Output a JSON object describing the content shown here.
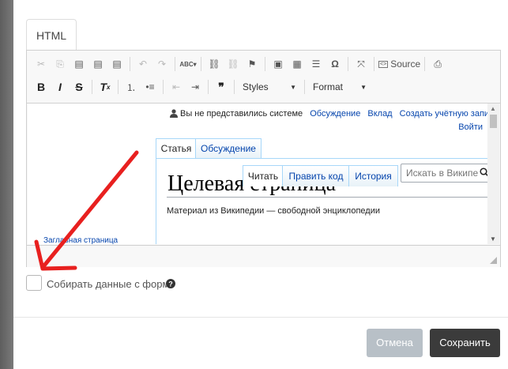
{
  "tabs": {
    "html": "HTML"
  },
  "toolbar": {
    "row1": [
      "✂",
      "⎘",
      "📋",
      "📋",
      "📋",
      "↶",
      "↷",
      "ABC",
      "🔗",
      "⛓",
      "⚑",
      "🖼",
      "▦",
      "═",
      "Ω",
      "⛶",
      "Source",
      "🔍"
    ],
    "source_label": "Source",
    "styles_label": "Styles",
    "format_label": "Format",
    "bold": "B",
    "italic": "I",
    "strike": "S",
    "removeformat": "Ix",
    "quote": "❞"
  },
  "wiki": {
    "not_logged_in": "Вы не представились системе",
    "discussion_link": "Обсуждение",
    "contributions_link": "Вклад",
    "create_account_link": "Создать учётную запись",
    "login_link": "Войти",
    "tab_article": "Статья",
    "tab_discussion": "Обсуждение",
    "action_read": "Читать",
    "action_edit": "Править код",
    "action_history": "История",
    "search_placeholder": "Искать в Википе",
    "page_title": "Целевая страница",
    "tagline": "Материал из Википедии — свободной энциклопедии",
    "main_page": "Заглавная страница"
  },
  "form": {
    "collect_data_label": "Собирать данные с форм"
  },
  "footer": {
    "cancel": "Отмена",
    "save": "Сохранить"
  },
  "colors": {
    "link": "#0645ad",
    "annotation_arrow": "#e8201f",
    "save_bg": "#3b3b3b",
    "cancel_bg": "#b8c0c7"
  }
}
